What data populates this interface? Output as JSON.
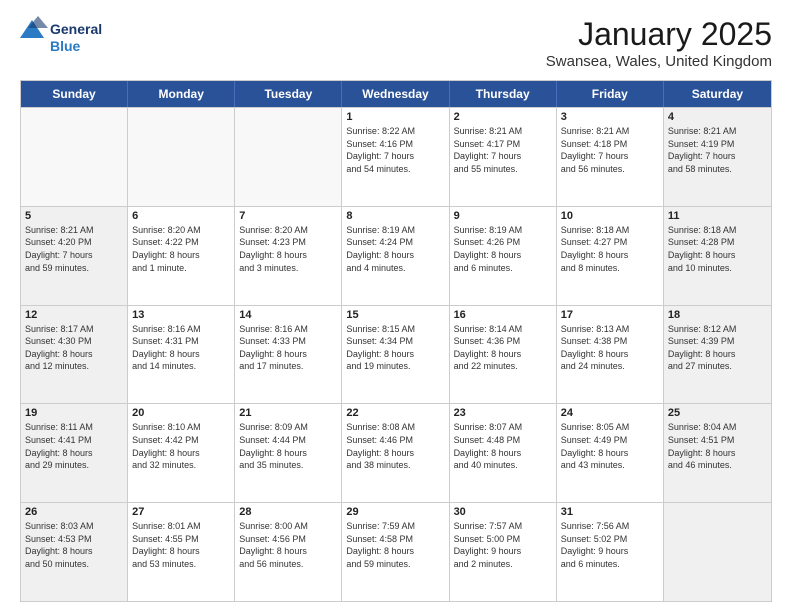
{
  "header": {
    "logo_line1": "General",
    "logo_line2": "Blue",
    "title": "January 2025",
    "subtitle": "Swansea, Wales, United Kingdom"
  },
  "weekdays": [
    "Sunday",
    "Monday",
    "Tuesday",
    "Wednesday",
    "Thursday",
    "Friday",
    "Saturday"
  ],
  "weeks": [
    [
      {
        "day": "",
        "info": "",
        "empty": true
      },
      {
        "day": "",
        "info": "",
        "empty": true
      },
      {
        "day": "",
        "info": "",
        "empty": true
      },
      {
        "day": "1",
        "info": "Sunrise: 8:22 AM\nSunset: 4:16 PM\nDaylight: 7 hours\nand 54 minutes.",
        "empty": false
      },
      {
        "day": "2",
        "info": "Sunrise: 8:21 AM\nSunset: 4:17 PM\nDaylight: 7 hours\nand 55 minutes.",
        "empty": false
      },
      {
        "day": "3",
        "info": "Sunrise: 8:21 AM\nSunset: 4:18 PM\nDaylight: 7 hours\nand 56 minutes.",
        "empty": false
      },
      {
        "day": "4",
        "info": "Sunrise: 8:21 AM\nSunset: 4:19 PM\nDaylight: 7 hours\nand 58 minutes.",
        "empty": false,
        "shaded": true
      }
    ],
    [
      {
        "day": "5",
        "info": "Sunrise: 8:21 AM\nSunset: 4:20 PM\nDaylight: 7 hours\nand 59 minutes.",
        "empty": false,
        "shaded": true
      },
      {
        "day": "6",
        "info": "Sunrise: 8:20 AM\nSunset: 4:22 PM\nDaylight: 8 hours\nand 1 minute.",
        "empty": false
      },
      {
        "day": "7",
        "info": "Sunrise: 8:20 AM\nSunset: 4:23 PM\nDaylight: 8 hours\nand 3 minutes.",
        "empty": false
      },
      {
        "day": "8",
        "info": "Sunrise: 8:19 AM\nSunset: 4:24 PM\nDaylight: 8 hours\nand 4 minutes.",
        "empty": false
      },
      {
        "day": "9",
        "info": "Sunrise: 8:19 AM\nSunset: 4:26 PM\nDaylight: 8 hours\nand 6 minutes.",
        "empty": false
      },
      {
        "day": "10",
        "info": "Sunrise: 8:18 AM\nSunset: 4:27 PM\nDaylight: 8 hours\nand 8 minutes.",
        "empty": false
      },
      {
        "day": "11",
        "info": "Sunrise: 8:18 AM\nSunset: 4:28 PM\nDaylight: 8 hours\nand 10 minutes.",
        "empty": false,
        "shaded": true
      }
    ],
    [
      {
        "day": "12",
        "info": "Sunrise: 8:17 AM\nSunset: 4:30 PM\nDaylight: 8 hours\nand 12 minutes.",
        "empty": false,
        "shaded": true
      },
      {
        "day": "13",
        "info": "Sunrise: 8:16 AM\nSunset: 4:31 PM\nDaylight: 8 hours\nand 14 minutes.",
        "empty": false
      },
      {
        "day": "14",
        "info": "Sunrise: 8:16 AM\nSunset: 4:33 PM\nDaylight: 8 hours\nand 17 minutes.",
        "empty": false
      },
      {
        "day": "15",
        "info": "Sunrise: 8:15 AM\nSunset: 4:34 PM\nDaylight: 8 hours\nand 19 minutes.",
        "empty": false
      },
      {
        "day": "16",
        "info": "Sunrise: 8:14 AM\nSunset: 4:36 PM\nDaylight: 8 hours\nand 22 minutes.",
        "empty": false
      },
      {
        "day": "17",
        "info": "Sunrise: 8:13 AM\nSunset: 4:38 PM\nDaylight: 8 hours\nand 24 minutes.",
        "empty": false
      },
      {
        "day": "18",
        "info": "Sunrise: 8:12 AM\nSunset: 4:39 PM\nDaylight: 8 hours\nand 27 minutes.",
        "empty": false,
        "shaded": true
      }
    ],
    [
      {
        "day": "19",
        "info": "Sunrise: 8:11 AM\nSunset: 4:41 PM\nDaylight: 8 hours\nand 29 minutes.",
        "empty": false,
        "shaded": true
      },
      {
        "day": "20",
        "info": "Sunrise: 8:10 AM\nSunset: 4:42 PM\nDaylight: 8 hours\nand 32 minutes.",
        "empty": false
      },
      {
        "day": "21",
        "info": "Sunrise: 8:09 AM\nSunset: 4:44 PM\nDaylight: 8 hours\nand 35 minutes.",
        "empty": false
      },
      {
        "day": "22",
        "info": "Sunrise: 8:08 AM\nSunset: 4:46 PM\nDaylight: 8 hours\nand 38 minutes.",
        "empty": false
      },
      {
        "day": "23",
        "info": "Sunrise: 8:07 AM\nSunset: 4:48 PM\nDaylight: 8 hours\nand 40 minutes.",
        "empty": false
      },
      {
        "day": "24",
        "info": "Sunrise: 8:05 AM\nSunset: 4:49 PM\nDaylight: 8 hours\nand 43 minutes.",
        "empty": false
      },
      {
        "day": "25",
        "info": "Sunrise: 8:04 AM\nSunset: 4:51 PM\nDaylight: 8 hours\nand 46 minutes.",
        "empty": false,
        "shaded": true
      }
    ],
    [
      {
        "day": "26",
        "info": "Sunrise: 8:03 AM\nSunset: 4:53 PM\nDaylight: 8 hours\nand 50 minutes.",
        "empty": false,
        "shaded": true
      },
      {
        "day": "27",
        "info": "Sunrise: 8:01 AM\nSunset: 4:55 PM\nDaylight: 8 hours\nand 53 minutes.",
        "empty": false
      },
      {
        "day": "28",
        "info": "Sunrise: 8:00 AM\nSunset: 4:56 PM\nDaylight: 8 hours\nand 56 minutes.",
        "empty": false
      },
      {
        "day": "29",
        "info": "Sunrise: 7:59 AM\nSunset: 4:58 PM\nDaylight: 8 hours\nand 59 minutes.",
        "empty": false
      },
      {
        "day": "30",
        "info": "Sunrise: 7:57 AM\nSunset: 5:00 PM\nDaylight: 9 hours\nand 2 minutes.",
        "empty": false
      },
      {
        "day": "31",
        "info": "Sunrise: 7:56 AM\nSunset: 5:02 PM\nDaylight: 9 hours\nand 6 minutes.",
        "empty": false
      },
      {
        "day": "",
        "info": "",
        "empty": true,
        "shaded": true
      }
    ]
  ]
}
